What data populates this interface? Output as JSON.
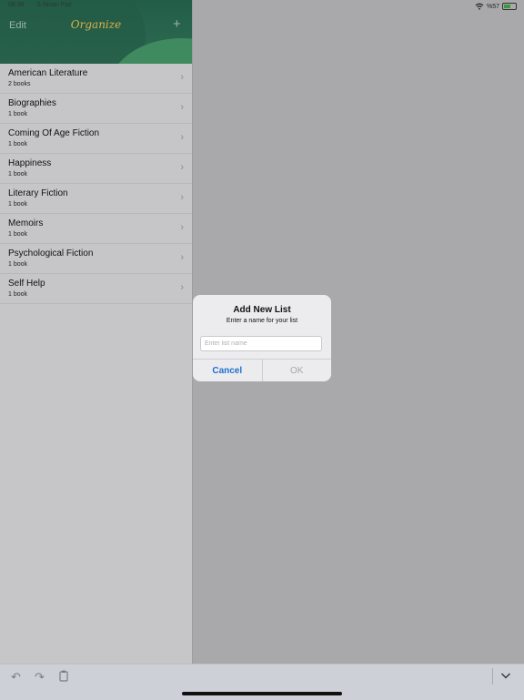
{
  "status": {
    "time": "08:38",
    "date": "5 Nisan Paz",
    "battery": "%57"
  },
  "header": {
    "edit_label": "Edit",
    "title": "Organize",
    "add_label": "+"
  },
  "lists": [
    {
      "name": "American Literature",
      "count": "2 books"
    },
    {
      "name": "Biographies",
      "count": "1 book"
    },
    {
      "name": "Coming Of Age Fiction",
      "count": "1 book"
    },
    {
      "name": "Happiness",
      "count": "1 book"
    },
    {
      "name": "Literary Fiction",
      "count": "1 book"
    },
    {
      "name": "Memoirs",
      "count": "1 book"
    },
    {
      "name": "Psychological Fiction",
      "count": "1 book"
    },
    {
      "name": "Self Help",
      "count": "1 book"
    }
  ],
  "dialog": {
    "title": "Add New List",
    "message": "Enter a name for your list",
    "input_placeholder": "Enter list name",
    "input_value": "",
    "cancel_label": "Cancel",
    "ok_label": "OK"
  },
  "icons": {
    "undo": "undo-icon",
    "redo": "redo-icon",
    "paste": "clipboard-icon",
    "dismiss": "chevron-down-icon",
    "chevron": "chevron-right-icon",
    "wifi": "wifi-icon",
    "battery": "battery-icon"
  },
  "colors": {
    "header": "#2e6b52",
    "title": "#d9b249",
    "accent": "#1f6fd0"
  }
}
